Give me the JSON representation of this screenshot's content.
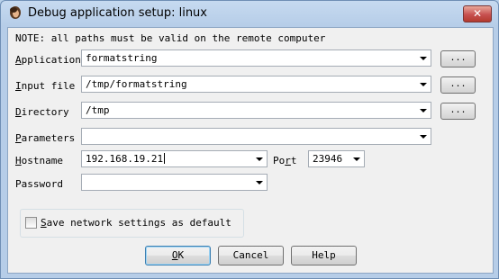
{
  "window": {
    "title": "Debug application setup: linux",
    "close_label": "✕"
  },
  "note": "NOTE: all paths must be valid on the remote computer",
  "fields": {
    "application": {
      "label_pre": "",
      "label_u": "A",
      "label_post": "pplication",
      "value": "formatstring",
      "browse": "..."
    },
    "input_file": {
      "label_pre": "",
      "label_u": "I",
      "label_post": "nput file",
      "value": "/tmp/formatstring",
      "browse": "..."
    },
    "directory": {
      "label_pre": "",
      "label_u": "D",
      "label_post": "irectory",
      "value": "/tmp",
      "browse": "..."
    },
    "parameters": {
      "label_pre": "",
      "label_u": "P",
      "label_post": "arameters",
      "value": ""
    },
    "hostname": {
      "label_pre": "",
      "label_u": "H",
      "label_post": "ostname",
      "value": "192.168.19.21"
    },
    "port": {
      "label_pre": "Po",
      "label_u": "r",
      "label_post": "t",
      "value": "23946"
    },
    "password": {
      "label": "Password",
      "value": ""
    }
  },
  "save_settings": {
    "label_pre": "",
    "label_u": "S",
    "label_post": "ave network settings as default",
    "checked": false
  },
  "buttons": {
    "ok": {
      "u": "O",
      "rest": "K"
    },
    "cancel": "Cancel",
    "help": "Help"
  }
}
